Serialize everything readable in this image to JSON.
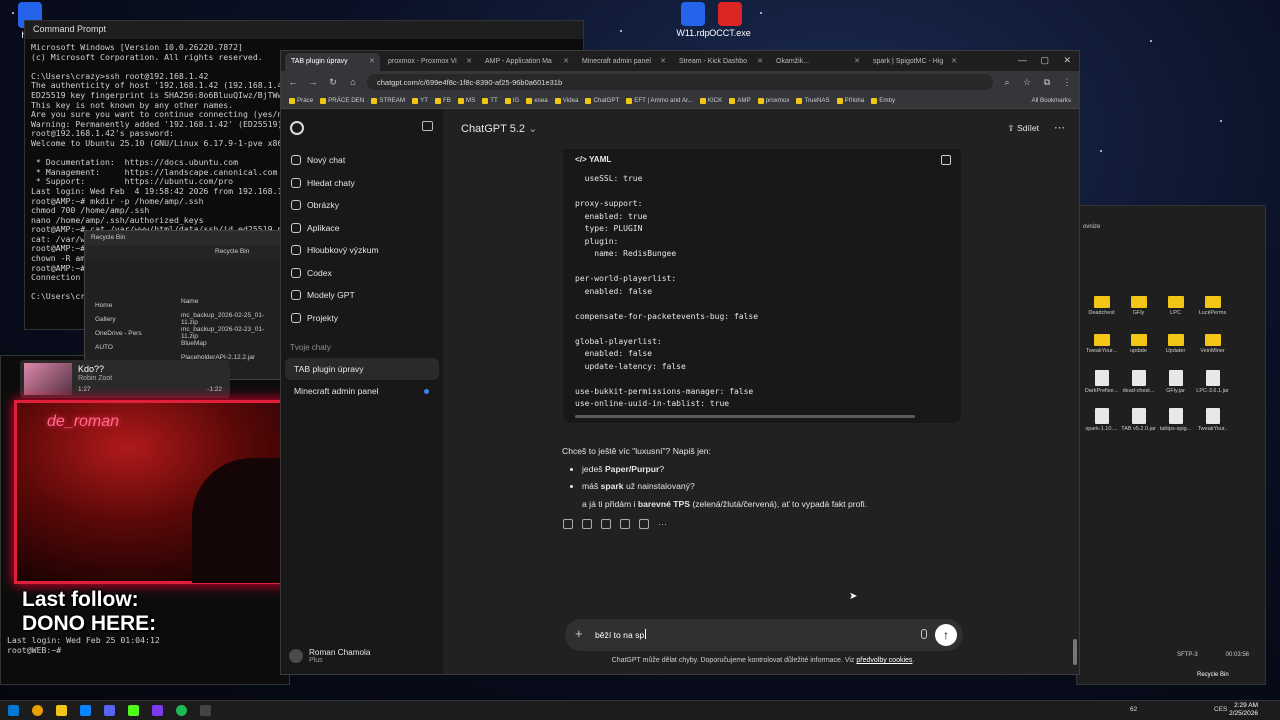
{
  "desktop": {
    "icons_top": [
      {
        "label": "html",
        "color": "#2563eb"
      },
      {
        "label": "W11.rdp",
        "color": "#2563eb"
      },
      {
        "label": "OCCT.exe",
        "color": "#dc2626"
      }
    ],
    "recycle_label": "Recycle Bin"
  },
  "terminal": {
    "title": "Command Prompt",
    "lines": "Microsoft Windows [Version 10.0.26220.7872]\n(c) Microsoft Corporation. All rights reserved.\n\nC:\\Users\\crazy>ssh root@192.168.1.42\nThe authenticity of host '192.168.1.42 (192.168.1.42)'\nED25519 key fingerprint is SHA256:8o6BluuQIwz/BjTWwBzpe\nThis key is not known by any other names.\nAre you sure you want to continue connecting (yes/no/[f\nWarning: Permanently added '192.168.1.42' (ED25519) to\nroot@192.168.1.42's password:\nWelcome to Ubuntu 25.10 (GNU/Linux 6.17.9-1-pve x86_64)\n\n * Documentation:  https://docs.ubuntu.com\n * Management:     https://landscape.canonical.com\n * Support:        https://ubuntu.com/pro\nLast login: Wed Feb  4 19:58:42 2026 from 192.168.1.30\nroot@AMP:~# mkdir -p /home/amp/.ssh\nchmod 700 /home/amp/.ssh\nnano /home/amp/.ssh/authorized_keys\nroot@AMP:~# cat /var/www/html/data/ssh/id_ed25519.pub\ncat: /var/www\nroot@AMP:~#\nchown -R amp\nroot@AMP:~#\nConnection t\n\nC:\\Users\\cra"
  },
  "terminal2": {
    "lines": "Last login: Wed Feb 25 01:04:12\nroot@WEB:~#"
  },
  "recycle_window": {
    "title": "Recycle Bin",
    "path": "Recycle Bin",
    "nav": [
      "Home",
      "Gallery",
      "OneDrive - Pers",
      "AUTO"
    ],
    "column_name": "Name",
    "files": [
      "mc_backup_2026-02-25_01-11.zip",
      "mc_backup_2026-02-23_01-11.zip",
      "BlueMap",
      "PlaceholderAPI-2.12.2.jar"
    ]
  },
  "media": {
    "title": "Kdo??",
    "artist": "Robin Zoot",
    "elapsed": "1:27",
    "remaining": "-1:22",
    "progress": 0.52
  },
  "webcam": {
    "neon_text": "de_roman"
  },
  "overlay": {
    "line1": "Last follow:",
    "line2": "DONO HERE:"
  },
  "explorer": {
    "nav_item": "ovnize",
    "items": [
      {
        "name": "Deadchest",
        "type": "folder"
      },
      {
        "name": "GFly",
        "type": "folder"
      },
      {
        "name": "LPC",
        "type": "folder"
      },
      {
        "name": "LuckPerms",
        "type": "folder"
      },
      {
        "name": "TweakYour...",
        "type": "folder"
      },
      {
        "name": "update",
        "type": "folder"
      },
      {
        "name": "Updater",
        "type": "folder"
      },
      {
        "name": "VeinMiner",
        "type": "folder"
      },
      {
        "name": "DarkPrefixe...",
        "type": "jar"
      },
      {
        "name": "dead-chest...",
        "type": "jar"
      },
      {
        "name": "GFly.jar",
        "type": "jar"
      },
      {
        "name": "LPC-3.6.1.jar",
        "type": "jar"
      },
      {
        "name": "spark-1.10....",
        "type": "jar"
      },
      {
        "name": "TAB v5.2.0.jar",
        "type": "jar"
      },
      {
        "name": "tabtps-spig...",
        "type": "jar"
      },
      {
        "name": "TweakYour..",
        "type": "jar"
      }
    ],
    "status": "SFTP-3",
    "time": "00:03:56"
  },
  "browser": {
    "tabs": [
      {
        "label": "TAB plugin úpravy",
        "active": true
      },
      {
        "label": "proxmox - Proxmox Vi",
        "active": false
      },
      {
        "label": "AMP - Application Ma",
        "active": false
      },
      {
        "label": "Minecraft admin panel",
        "active": false
      },
      {
        "label": "Stream - Kick Dashbo",
        "active": false
      },
      {
        "label": "Okamžik...",
        "active": false
      },
      {
        "label": "spark | SpigotMC - Hig",
        "active": false
      }
    ],
    "url": "chatgpt.com/c/699e4f8c-1f8c-8390-af25-96b0a601e31b",
    "bookmarks": [
      "Práce",
      "PRÁCE DEN",
      "STREAM",
      "YT",
      "FB",
      "MS",
      "TT",
      "IG",
      "esea",
      "Videa",
      "ChatGPT",
      "EFT | Ammo and Ar...",
      "KICK",
      "AMP",
      "proxmox",
      "TrueNAS",
      "Příloha",
      "Emby"
    ],
    "all_bookmarks": "All Bookmarks"
  },
  "sidebar": {
    "items": [
      {
        "label": "Nový chat",
        "icon": "new-chat-icon"
      },
      {
        "label": "Hledat chaty",
        "icon": "search-icon"
      },
      {
        "label": "Obrázky",
        "icon": "image-icon"
      },
      {
        "label": "Aplikace",
        "icon": "apps-icon"
      },
      {
        "label": "Hloubkový výzkum",
        "icon": "research-icon"
      },
      {
        "label": "Codex",
        "icon": "codex-icon"
      },
      {
        "label": "Modely GPT",
        "icon": "models-icon"
      },
      {
        "label": "Projekty",
        "icon": "folder-icon"
      }
    ],
    "section_title": "Tvoje chaty",
    "chats": [
      {
        "label": "TAB plugin úpravy",
        "active": true
      },
      {
        "label": "Minecraft admin panel",
        "active": false
      }
    ],
    "user_name": "Roman Chamola",
    "user_plan": "Plus"
  },
  "header": {
    "model": "ChatGPT 5.2",
    "share": "Sdílet"
  },
  "code_block": {
    "language": "YAML",
    "content": "  useSSL: true\n\nproxy-support:\n  enabled: true\n  type: PLUGIN\n  plugin:\n    name: RedisBungee\n\nper-world-playerlist:\n  enabled: false\n\ncompensate-for-packetevents-bug: false\n\nglobal-playerlist:\n  enabled: false\n  update-latency: false\n\nuse-bukkit-permissions-manager: false\nuse-online-uuid-in-tablist: true"
  },
  "reply": {
    "intro": "Chceš to ještě víc \"luxusní\"? Napiš jen:",
    "b1_pre": "jedeš ",
    "b1_bold": "Paper/Purpur",
    "b1_post": "?",
    "b2_pre": "máš ",
    "b2_bold": "spark",
    "b2_post": " už nainstalovaný?",
    "line3_pre": "a já ti přidám i ",
    "line3_bold": "barevné TPS",
    "line3_post": " (zelená/žlutá/červená), ať to vypadá fakt profi."
  },
  "composer": {
    "text": "běží to na sp"
  },
  "disclaimer": {
    "text": "ChatGPT může dělat chyby. Doporučujeme kontrolovat důležité informace. Viz ",
    "link": "předvolby cookies",
    "end": "."
  },
  "taskbar": {
    "time": "2:29 AM",
    "date": "2/25/2026",
    "lang": "CES",
    "temp": "62"
  },
  "colors": {
    "sidebar_bg": "#181818",
    "main_bg": "#212121",
    "accent_blue": "#3b82f6",
    "webcam_border": "#e0203a"
  }
}
